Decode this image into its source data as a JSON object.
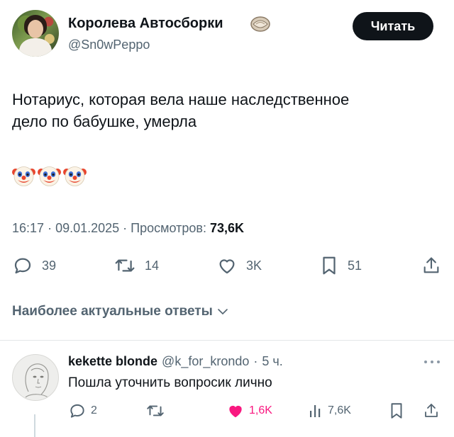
{
  "header": {
    "display_name": "Королева Автосборки",
    "handle": "@Sn0wPeppo",
    "follow_label": "Читать",
    "badge_icon": "shell-emoji-icon"
  },
  "tweet": {
    "text_line1": "Нотариус, которая вела наше наследственное",
    "text_line2": "дело по бабушке, умерла",
    "emojis": [
      "clown-face-icon",
      "clown-face-icon",
      "clown-face-icon"
    ],
    "time": "16:17",
    "date": "09.01.2025",
    "views_label": "Просмотров:",
    "views_value": "73,6K"
  },
  "actions": {
    "replies": "39",
    "retweets": "14",
    "likes": "3K",
    "bookmarks": "51"
  },
  "replies_filter": {
    "label": "Наиболее актуальные ответы"
  },
  "reply": {
    "name": "kekette blonde",
    "handle": "@k_for_krondo",
    "time": "5 ч.",
    "text": "Пошла уточнить вопросик лично",
    "replies": "2",
    "likes": "1,6K",
    "views": "7,6K"
  },
  "colors": {
    "text": "#0f1419",
    "secondary": "#536471",
    "like": "#f91880"
  }
}
